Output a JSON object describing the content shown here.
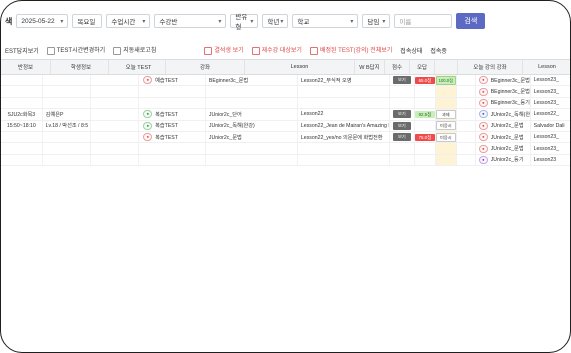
{
  "toolbar": {
    "title_suffix": "색",
    "date": "2025-05-22",
    "weekday": "목요일",
    "class_time": "수업시간",
    "course": "수강반",
    "section": "반유형",
    "grade": "학년",
    "school": "학교",
    "teacher": "담임",
    "name_placeholder": "이름",
    "search_label": "검색"
  },
  "filters": {
    "f1": "EST답지보기",
    "f2": "TEST시간변경하기",
    "f3": "지동새로고침",
    "f4": "결석생 보기",
    "f5": "재수강 대상보기",
    "f6": "배정된 TEST(강의) 전체보기",
    "f7": "접속상태",
    "f8": "접속중"
  },
  "header": {
    "h1": "반정보",
    "h2": "학생정보",
    "h3": "오늘 TEST",
    "h4": "강좌",
    "h5": "Lesson",
    "h6": "W B답지",
    "h7": "점수",
    "h8": "오답",
    "h9": "",
    "h10": "오늘 강의 강좌",
    "h11": "Lesson"
  },
  "rows": [
    {
      "c1": "",
      "c2": "",
      "c3": "",
      "test": "예습TEST",
      "course": "BEginner3c_문법",
      "lesson": "Lesson22_무식적 오영",
      "score": "65.0점",
      "wrong": "100.0점",
      "note": "",
      "c10": "BEginner3c_문법",
      "c11": "Lesson23_",
      "tag": "red",
      "tag2": "red"
    },
    {
      "c1": "",
      "c2": "",
      "c3": "",
      "test": "",
      "course": "",
      "lesson": "",
      "score": "",
      "wrong": "",
      "note": "",
      "c10": "BEginner3c_문법",
      "c11": "Lesson23_",
      "tag": "",
      "tag2": "red"
    },
    {
      "c1": "",
      "c2": "",
      "c3": "",
      "test": "",
      "course": "",
      "lesson": "",
      "score": "",
      "wrong": "",
      "note": "",
      "c10": "BEginner3c_등기",
      "c11": "Lesson23_",
      "tag": "",
      "tag2": "red"
    },
    {
      "c1": "SJU2c화목3",
      "c2": "김예은P",
      "c3": "",
      "test": "복습TEST",
      "course": "JUnior2c_단어",
      "lesson": "Lesson22",
      "score": "92.5점",
      "wrong": "과제",
      "note": "",
      "c10": "JUnior2c_독해(완강)",
      "c11": "Lesson22_",
      "tag": "green",
      "tag2": "blue"
    },
    {
      "c1": "15:50~18:10",
      "c2": "Lv.18 / 박선조 / 8:5",
      "c3": "",
      "test": "복습TEST",
      "course": "JUnior2c_독해(완강)",
      "lesson": "Lesson22_Jean de Mairan's Amazing Discovery",
      "score": "",
      "wrong": "미응시",
      "note": "",
      "c10": "JUnior2c_문법",
      "c11": "Salvador Dali",
      "tag": "green",
      "tag2": "red"
    },
    {
      "c1": "",
      "c2": "",
      "c3": "",
      "test": "복습TEST",
      "course": "JUnior2c_문법",
      "lesson": "Lesson22_yes/no 의문문에 화법전환",
      "score": "75.0점",
      "wrong": "미응시",
      "note": "",
      "c10": "JUnior2c_문법",
      "c11": "Lesson23_",
      "tag": "red",
      "tag2": "red"
    },
    {
      "c1": "",
      "c2": "",
      "c3": "",
      "test": "",
      "course": "",
      "lesson": "",
      "score": "",
      "wrong": "",
      "note": "",
      "c10": "JUnior2c_문법",
      "c11": "Lesson23_",
      "tag": "",
      "tag2": "red"
    },
    {
      "c1": "",
      "c2": "",
      "c3": "",
      "test": "",
      "course": "",
      "lesson": "",
      "score": "",
      "wrong": "",
      "note": "",
      "c10": "JUnior2c_등기",
      "c11": "Lesson23",
      "tag": "",
      "tag2": "purple"
    }
  ]
}
